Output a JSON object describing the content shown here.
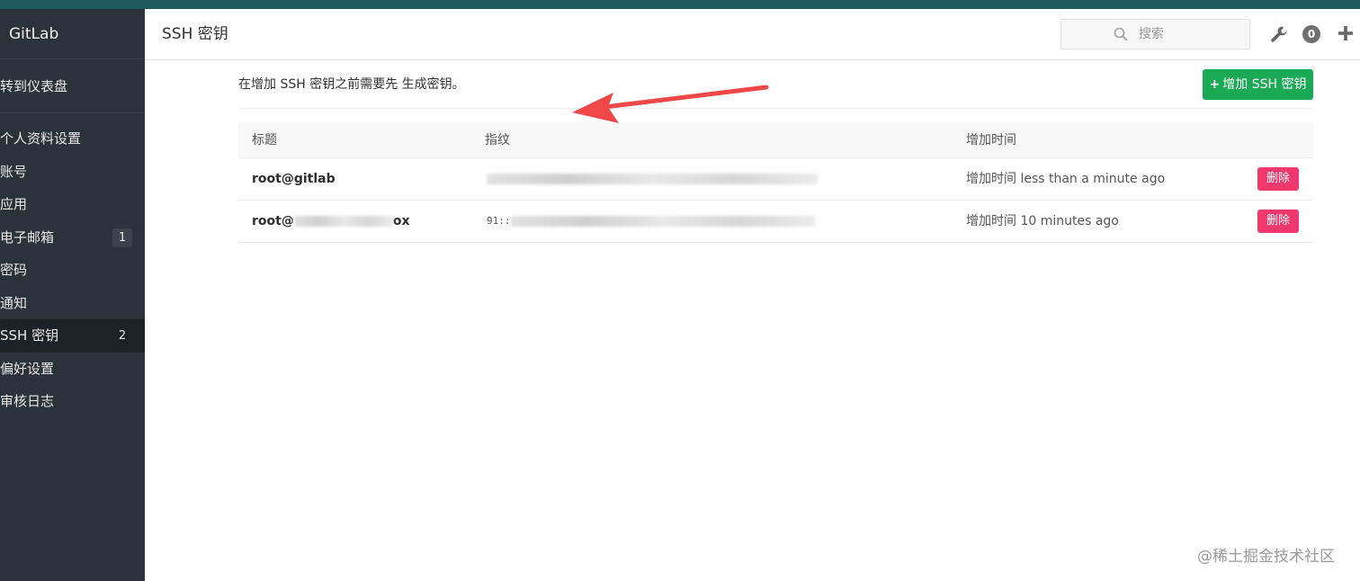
{
  "topbar": {
    "color": "#1f5a5e"
  },
  "sidebar": {
    "brand": "GitLab",
    "back_link": "转到仪表盘",
    "items": [
      {
        "label": "个人资料设置",
        "badge": ""
      },
      {
        "label": "账号",
        "badge": ""
      },
      {
        "label": "应用",
        "badge": ""
      },
      {
        "label": "电子邮箱",
        "badge": "1"
      },
      {
        "label": "密码",
        "badge": ""
      },
      {
        "label": "通知",
        "badge": ""
      },
      {
        "label": "SSH 密钥",
        "badge": "2",
        "active": true
      },
      {
        "label": "偏好设置",
        "badge": ""
      },
      {
        "label": "审核日志",
        "badge": ""
      }
    ]
  },
  "header": {
    "title": "SSH 密钥",
    "search": {
      "placeholder": "搜索",
      "icon": "search-icon"
    },
    "todo_count": "0",
    "icons": [
      "wrench-icon",
      "plus-icon"
    ]
  },
  "main": {
    "intro": "在增加 SSH 密钥之前需要先 生成密钥。",
    "add_button": {
      "plus": "+",
      "label": "增加 SSH 密钥",
      "color": "#1aaa55"
    },
    "table": {
      "columns": [
        "标题",
        "指纹",
        "增加时间"
      ],
      "rows": [
        {
          "title": "root@gitlab",
          "fingerprint": "",
          "added": "增加时间 less than a minute ago",
          "delete": "删除"
        },
        {
          "title_prefix": "root@",
          "title_suffix": "ox",
          "fingerprint_prefix": "91::",
          "added": "增加时间 10 minutes ago",
          "delete": "删除"
        }
      ]
    },
    "delete_color": "#f0386c",
    "annotation_color": "#f04848"
  },
  "watermark": "@稀土掘金技术社区"
}
